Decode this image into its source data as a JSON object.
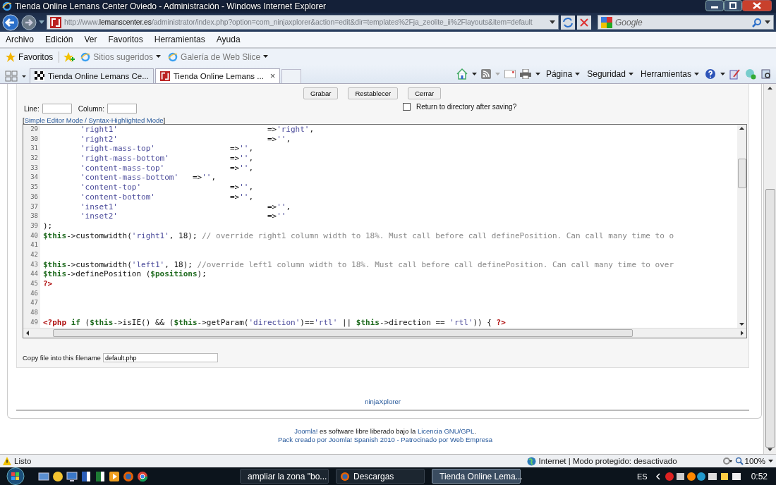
{
  "window": {
    "title": "Tienda Online Lemans Center Oviedo - Administración - Windows Internet Explorer"
  },
  "address": {
    "prefix": "http://www.",
    "domain": "lemanscenter.es",
    "path": "/administrator/index.php?option=com_ninjaxplorer&action=edit&dir=templates%2Fja_zeolite_ii%2Flayouts&item=default"
  },
  "search": {
    "placeholder": "Google"
  },
  "menu": [
    "Archivo",
    "Edición",
    "Ver",
    "Favoritos",
    "Herramientas",
    "Ayuda"
  ],
  "favorites_bar": {
    "favorites": "Favoritos",
    "links": [
      "Sitios sugeridos",
      "Galería de Web Slice"
    ]
  },
  "tabs": [
    {
      "label": "Tienda Online Lemans Ce...",
      "selected": false
    },
    {
      "label": "Tienda Online Lemans ...",
      "selected": true,
      "close": "×"
    }
  ],
  "command_bar": [
    "Página",
    "Seguridad",
    "Herramientas"
  ],
  "editor": {
    "buttons": [
      "Grabar",
      "Restablecer",
      "Cerrar"
    ],
    "line_label": "Line:",
    "column_label": "Column:",
    "return_checkbox": {
      "label": "Return to directory after saving?",
      "checked": false
    },
    "mode_open": "[",
    "mode_link": "Simple Editor Mode / Syntax-Highlighted Mode",
    "mode_close": "]",
    "lines": [
      {
        "num": "29",
        "indented": true,
        "tokens": [
          {
            "kind": "str",
            "text": "'right1'"
          },
          {
            "kind": "op",
            "text": "                                =>"
          },
          {
            "kind": "str",
            "text": "'right'"
          },
          {
            "kind": "op",
            "text": ","
          }
        ]
      },
      {
        "num": "30",
        "indented": true,
        "tokens": [
          {
            "kind": "str",
            "text": "'right2'"
          },
          {
            "kind": "op",
            "text": "                                =>"
          },
          {
            "kind": "str",
            "text": "''"
          },
          {
            "kind": "op",
            "text": ","
          }
        ]
      },
      {
        "num": "31",
        "indented": true,
        "tokens": [
          {
            "kind": "str",
            "text": "'right-mass-top'"
          },
          {
            "kind": "op",
            "text": "                =>"
          },
          {
            "kind": "str",
            "text": "''"
          },
          {
            "kind": "op",
            "text": ","
          }
        ]
      },
      {
        "num": "32",
        "indented": true,
        "tokens": [
          {
            "kind": "str",
            "text": "'right-mass-bottom'"
          },
          {
            "kind": "op",
            "text": "             =>"
          },
          {
            "kind": "str",
            "text": "''"
          },
          {
            "kind": "op",
            "text": ","
          }
        ]
      },
      {
        "num": "33",
        "indented": true,
        "tokens": [
          {
            "kind": "str",
            "text": "'content-mass-top'"
          },
          {
            "kind": "op",
            "text": "              =>"
          },
          {
            "kind": "str",
            "text": "''"
          },
          {
            "kind": "op",
            "text": ","
          }
        ]
      },
      {
        "num": "34",
        "indented": true,
        "tokens": [
          {
            "kind": "str",
            "text": "'content-mass-bottom'"
          },
          {
            "kind": "op",
            "text": "   =>"
          },
          {
            "kind": "str",
            "text": "''"
          },
          {
            "kind": "op",
            "text": ","
          }
        ]
      },
      {
        "num": "35",
        "indented": true,
        "tokens": [
          {
            "kind": "str",
            "text": "'content-top'"
          },
          {
            "kind": "op",
            "text": "                   =>"
          },
          {
            "kind": "str",
            "text": "''"
          },
          {
            "kind": "op",
            "text": ","
          }
        ]
      },
      {
        "num": "36",
        "indented": true,
        "tokens": [
          {
            "kind": "str",
            "text": "'content-bottom'"
          },
          {
            "kind": "op",
            "text": "                =>"
          },
          {
            "kind": "str",
            "text": "''"
          },
          {
            "kind": "op",
            "text": ","
          }
        ]
      },
      {
        "num": "37",
        "indented": true,
        "tokens": [
          {
            "kind": "str",
            "text": "'inset1'"
          },
          {
            "kind": "op",
            "text": "                                =>"
          },
          {
            "kind": "str",
            "text": "''"
          },
          {
            "kind": "op",
            "text": ","
          }
        ]
      },
      {
        "num": "38",
        "indented": true,
        "tokens": [
          {
            "kind": "str",
            "text": "'inset2'"
          },
          {
            "kind": "op",
            "text": "                                =>"
          },
          {
            "kind": "str",
            "text": "''"
          }
        ]
      },
      {
        "num": "39",
        "tokens": [
          {
            "kind": "op",
            "text": ");"
          }
        ]
      },
      {
        "num": "40",
        "tokens": [
          {
            "kind": "var",
            "text": "$this"
          },
          {
            "kind": "op",
            "text": "->customwidth("
          },
          {
            "kind": "str",
            "text": "'right1'"
          },
          {
            "kind": "op",
            "text": ", 18); "
          },
          {
            "kind": "comment",
            "text": "// override right1 column width to 18%. Must call before call definePosition. Can call many time to o"
          }
        ]
      },
      {
        "num": "41"
      },
      {
        "num": "42"
      },
      {
        "num": "43",
        "tokens": [
          {
            "kind": "var",
            "text": "$this"
          },
          {
            "kind": "op",
            "text": "->customwidth("
          },
          {
            "kind": "str",
            "text": "'left1'"
          },
          {
            "kind": "op",
            "text": ", 18); "
          },
          {
            "kind": "comment",
            "text": "//override left1 column width to 18%. Must call before call definePosition. Can call many time to over"
          }
        ]
      },
      {
        "num": "44",
        "tokens": [
          {
            "kind": "var",
            "text": "$this"
          },
          {
            "kind": "op",
            "text": "->definePosition ("
          },
          {
            "kind": "var",
            "text": "$positions"
          },
          {
            "kind": "op",
            "text": ");"
          }
        ]
      },
      {
        "num": "45",
        "tokens": [
          {
            "kind": "tag",
            "text": "?>"
          }
        ]
      },
      {
        "num": "46"
      },
      {
        "num": "47"
      },
      {
        "num": "48"
      },
      {
        "num": "49",
        "tokens": [
          {
            "kind": "tag",
            "text": "<?php"
          },
          {
            "kind": "kw",
            "text": " if"
          },
          {
            "kind": "op",
            "text": " ("
          },
          {
            "kind": "var",
            "text": "$this"
          },
          {
            "kind": "op",
            "text": "->isIE() && ("
          },
          {
            "kind": "var",
            "text": "$this"
          },
          {
            "kind": "op",
            "text": "->getParam("
          },
          {
            "kind": "str",
            "text": "'direction'"
          },
          {
            "kind": "op",
            "text": ")=="
          },
          {
            "kind": "str",
            "text": "'rtl'"
          },
          {
            "kind": "op",
            "text": " || "
          },
          {
            "kind": "var",
            "text": "$this"
          },
          {
            "kind": "op",
            "text": "->direction == "
          },
          {
            "kind": "str",
            "text": "'rtl'"
          },
          {
            "kind": "op",
            "text": ")) { "
          },
          {
            "kind": "tag",
            "text": "?>"
          }
        ]
      }
    ],
    "copy_label": "Copy file into this filename",
    "copy_value": "default.php"
  },
  "footer": {
    "credit": "ninjaXplorer",
    "joomla": "Joomla!",
    "text": " es software libre liberado bajo la ",
    "license": "Licencia GNU/GPL",
    "end": ".",
    "pack": "Pack creado por Joomla! Spanish 2010 - Patrocinado por Web Empresa"
  },
  "status_bar": {
    "status": "Listo",
    "zone": "Internet | Modo protegido: desactivado",
    "zoom": "100%"
  },
  "taskbar": {
    "tasks": [
      {
        "label": "ampliar la zona \"bo...",
        "selected": false
      },
      {
        "label": "Descargas",
        "selected": false
      },
      {
        "label": "Tienda Online Lema...",
        "selected": true
      }
    ],
    "language": "ES",
    "time": "0:52"
  }
}
